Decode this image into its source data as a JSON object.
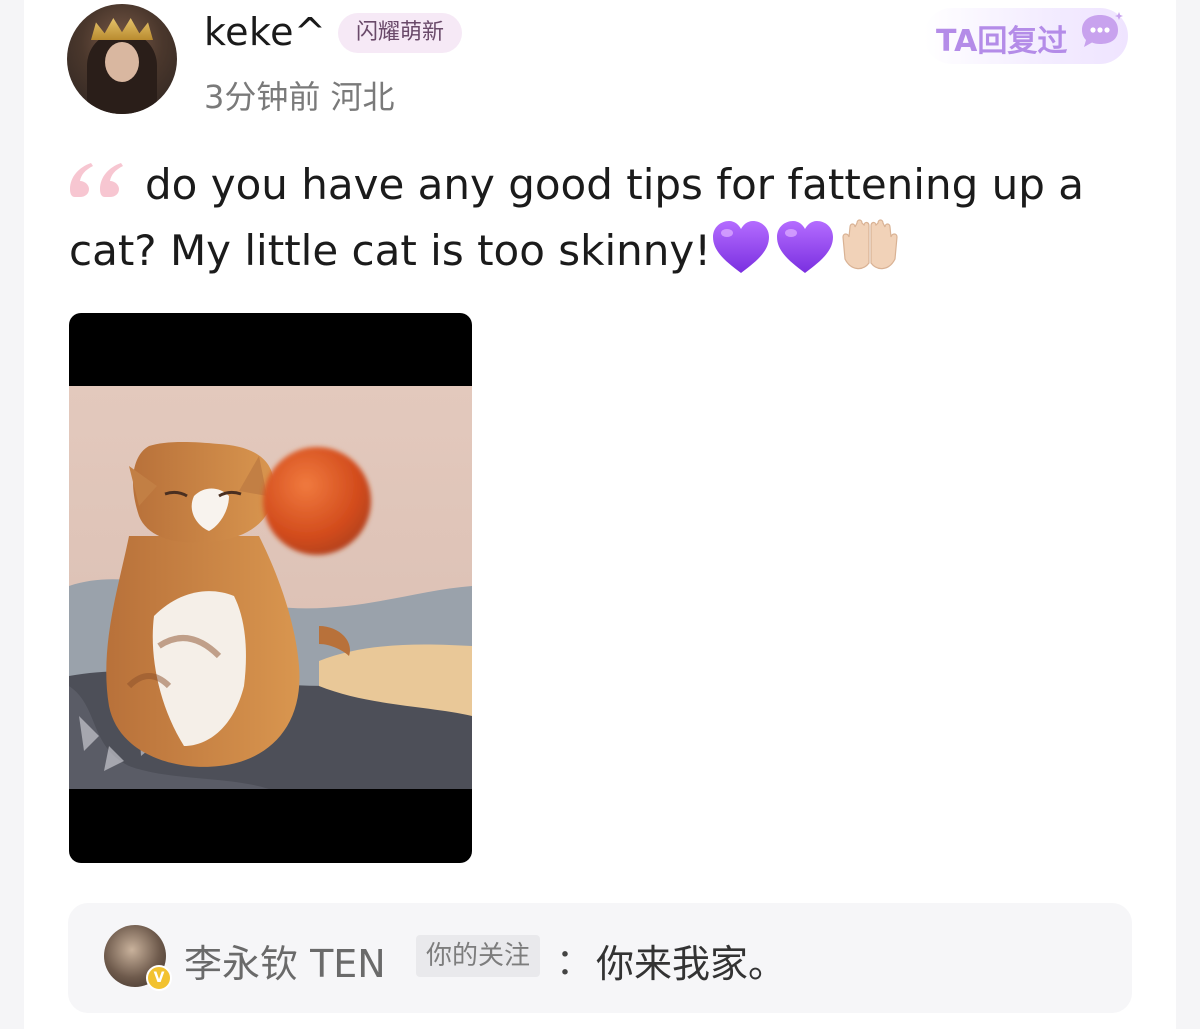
{
  "post": {
    "username": "keke^",
    "level_badge": "闪耀萌新",
    "meta": "3分钟前 河北",
    "reply_badge": "TA回复过",
    "text": "do you have any good tips for fattening up a cat? My little cat is too skinny!",
    "emojis": [
      "purple-heart",
      "purple-heart",
      "palms-up-together"
    ],
    "media": {
      "type": "video-thumbnail",
      "subject": "cat-with-orange-ball"
    }
  },
  "comment": {
    "name": "李永钦 TEN",
    "relation_tag": "你的关注",
    "separator": "：",
    "text": "你来我家。",
    "verified_icon": "v-badge"
  },
  "colors": {
    "accent_purple": "#b48ce8",
    "badge_bg": "#f6e9f6",
    "comment_bg": "#f6f6f8",
    "quote_mark": "#f4b9c6"
  }
}
